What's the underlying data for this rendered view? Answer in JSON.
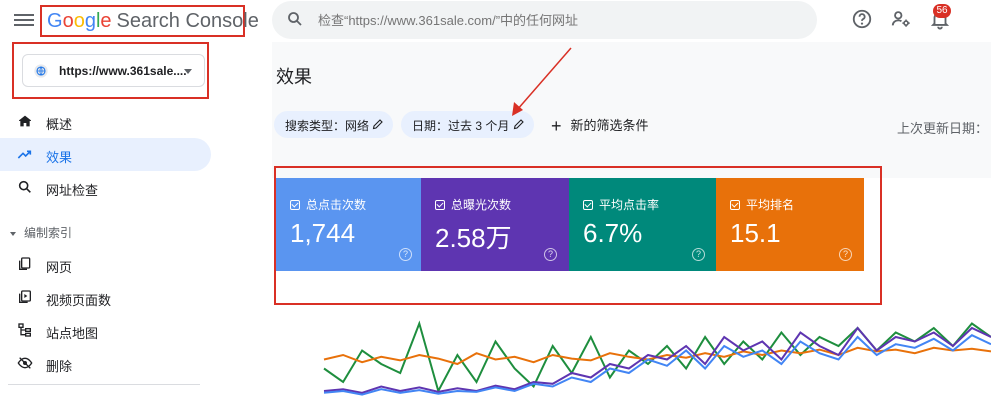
{
  "header": {
    "logo_google_letters": [
      "G",
      "o",
      "o",
      "g",
      "l",
      "e"
    ],
    "logo_product": "Search Console",
    "search_placeholder": "检查“https://www.361sale.com/”中的任何网址",
    "notification_count": "56",
    "icons": [
      "menu-icon",
      "search-icon",
      "help-icon",
      "manage-users-icon",
      "notifications-icon"
    ]
  },
  "sidebar": {
    "property": "https://www.361sale....",
    "items": [
      {
        "label": "概述",
        "icon": "home-icon"
      },
      {
        "label": "效果",
        "icon": "trending-up-icon"
      },
      {
        "label": "网址检查",
        "icon": "search-icon"
      }
    ],
    "section_title": "编制索引",
    "section_items": [
      {
        "label": "网页",
        "icon": "pages-icon"
      },
      {
        "label": "视频页面数",
        "icon": "video-pages-icon"
      },
      {
        "label": "站点地图",
        "icon": "sitemap-icon"
      },
      {
        "label": "删除",
        "icon": "removals-icon"
      }
    ]
  },
  "main": {
    "title": "效果",
    "chips": [
      {
        "label": "搜索类型：网络"
      },
      {
        "label": "日期：过去 3 个月"
      }
    ],
    "add_filter": "新的筛选条件",
    "last_updated": "上次更新日期：",
    "metrics": [
      {
        "label": "总点击次数",
        "value": "1,744",
        "color": "#5a95f0"
      },
      {
        "label": "总曝光次数",
        "value": "2.58万",
        "color": "#5e35b1"
      },
      {
        "label": "平均点击率",
        "value": "6.7%",
        "color": "#00897b"
      },
      {
        "label": "平均排名",
        "value": "15.1",
        "color": "#e8710a"
      }
    ]
  },
  "chart_data": {
    "type": "line",
    "series": [
      {
        "color": "#1e8e3e",
        "values": [
          35,
          20,
          55,
          40,
          30,
          85,
          10,
          50,
          20,
          65,
          35,
          15,
          60,
          30,
          70,
          25,
          55,
          40,
          60,
          35,
          70,
          40,
          65,
          45,
          75,
          50,
          70,
          60,
          80,
          55,
          75,
          65,
          80,
          60,
          85,
          70
        ]
      },
      {
        "color": "#e8710a",
        "values": [
          45,
          50,
          42,
          48,
          44,
          50,
          46,
          40,
          52,
          45,
          48,
          42,
          50,
          46,
          44,
          52,
          48,
          45,
          50,
          47,
          52,
          48,
          54,
          50,
          55,
          52,
          56,
          50,
          58,
          54,
          56,
          52,
          58,
          55,
          57,
          54
        ]
      },
      {
        "color": "#5e35b1",
        "values": [
          10,
          12,
          8,
          15,
          10,
          14,
          9,
          13,
          10,
          16,
          12,
          20,
          18,
          30,
          25,
          40,
          35,
          50,
          45,
          60,
          40,
          70,
          55,
          65,
          45,
          75,
          60,
          50,
          80,
          55,
          70,
          65,
          75,
          60,
          80,
          70
        ]
      },
      {
        "color": "#4285f4",
        "values": [
          8,
          10,
          6,
          12,
          8,
          11,
          7,
          10,
          9,
          14,
          10,
          18,
          15,
          25,
          20,
          35,
          30,
          45,
          38,
          55,
          35,
          60,
          48,
          55,
          40,
          65,
          52,
          45,
          70,
          50,
          62,
          58,
          68,
          55,
          72,
          62
        ]
      }
    ]
  }
}
